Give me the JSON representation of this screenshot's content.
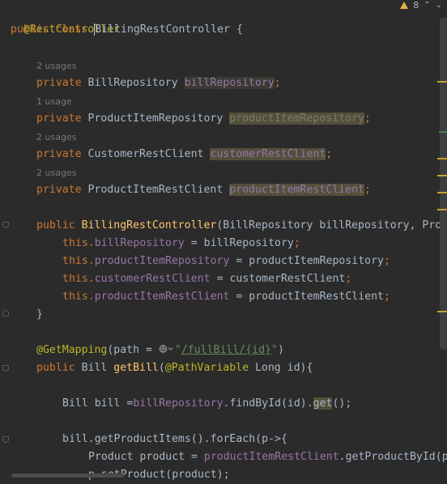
{
  "inspection": {
    "count": "8"
  },
  "code": {
    "l1_ann": "@RestController",
    "l2_public": "public",
    "l2_class": "class",
    "l2_caret_char": "B",
    "l2_name": "illingRestController",
    "l2_brace": " {",
    "u1": "2 usages",
    "u2": "1 usage",
    "u3": "2 usages",
    "u4": "2 usages",
    "f_private": "private",
    "f1_type": "BillRepository",
    "f1_name": "billRepository",
    "f2_type": "ProductItemRepository",
    "f2_name": "productItemRepository",
    "f3_type": "CustomerRestClient",
    "f3_name": "customerRestClient",
    "f4_type": "ProductItemRestClient",
    "f4_name": "productItemRestClient",
    "semi": ";",
    "ctor_public": "public",
    "ctor_name": "BillingRestController",
    "ctor_params": "(BillRepository billRepository, Prod",
    "this_kw": "this.",
    "a1_lhs": "billRepository",
    "a1_rhs": " = billRepository",
    "a2_lhs": "productItemRepository",
    "a2_rhs": " = productItemRepository",
    "a3_lhs": "customerRestClient",
    "a3_rhs": " = customerRestClient",
    "a4_lhs": "productItemRestClient",
    "a4_rhs": " = productItemRestClient",
    "close_brace": "}",
    "get_ann": "@GetMapping",
    "get_path_open": "(path = ",
    "get_q_open": "\"",
    "get_url": "/fullBill/{id}",
    "get_q_close": "\"",
    "get_paren": ")",
    "m_public": "public",
    "m_type": " Bill ",
    "m_name": "getBill",
    "m_paren": "(",
    "m_pv": "@PathVariable",
    "m_rest": " Long id){",
    "b1_pre": "Bill bill =",
    "b1_field": "billRepository",
    "b1_mid": ".findById(id).",
    "b1_get": "get",
    "b1_end": "();",
    "fe": "bill.getProductItems().forEach(p->{",
    "pp_pre": "Product product = ",
    "pp_field": "productItemRestClient",
    "pp_rest": ".getProductById(p.",
    "sp": "p.setProduct(product);"
  }
}
